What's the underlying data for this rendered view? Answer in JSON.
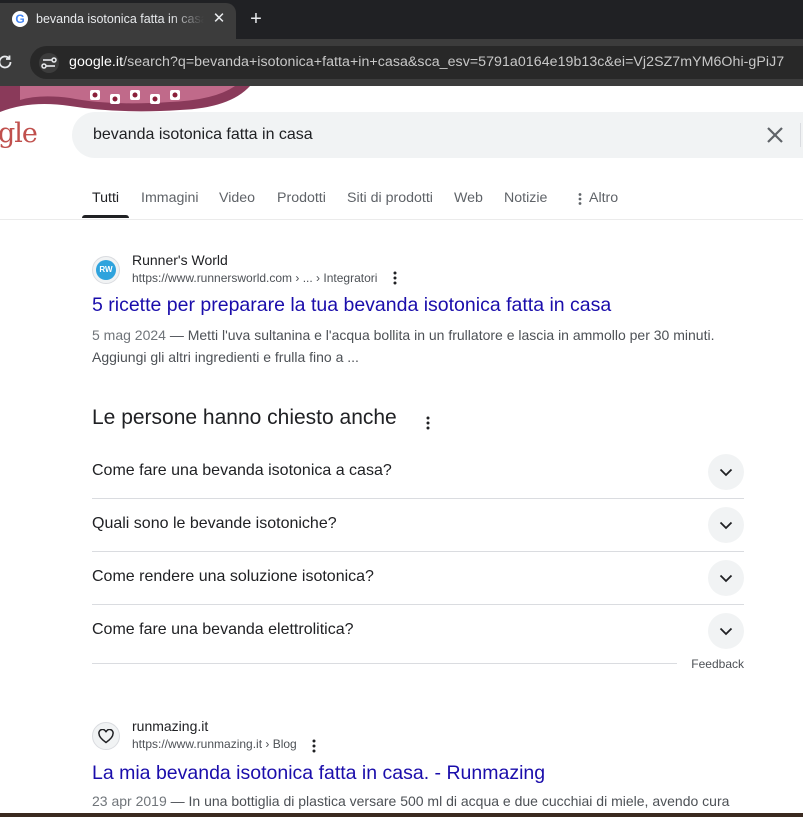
{
  "browser": {
    "tab_title": "bevanda isotonica fatta in casa - Cerca con Google",
    "tab_favicon_letter": "G",
    "close_glyph": "✕",
    "new_tab_glyph": "+",
    "url_host": "google.it",
    "url_rest": "/search?q=bevanda+isotonica+fatta+in+casa&sca_esv=5791a0164e19b13c&ei=Vj2SZ7mYM6Ohi-gPiJ7",
    "icons": [
      "reload-icon",
      "site-info-icon",
      "close-icon",
      "plus-icon"
    ]
  },
  "header": {
    "logo_fragment": "gle",
    "search_query": "bevanda isotonica fatta in casa",
    "clear_icon": "close-icon"
  },
  "nav": {
    "tabs": [
      {
        "label": "Tutti",
        "active": true
      },
      {
        "label": "Immagini"
      },
      {
        "label": "Video"
      },
      {
        "label": "Prodotti"
      },
      {
        "label": "Siti di prodotti"
      },
      {
        "label": "Web"
      },
      {
        "label": "Notizie"
      },
      {
        "label": "Altro"
      }
    ]
  },
  "results": [
    {
      "site_name": "Runner's World",
      "site_url": "https://www.runnersworld.com › ... › Integratori",
      "favicon_text": "RW",
      "title": "5 ricette per preparare la tua bevanda isotonica fatta in casa",
      "date": "5 mag 2024",
      "snippet": " — Metti l'uva sultanina e l'acqua bollita in un frullatore e lascia in ammollo per 30 minuti. Aggiungi gli altri ingredienti e frulla fino a ..."
    },
    {
      "site_name": "runmazing.it",
      "site_url": "https://www.runmazing.it › Blog",
      "favicon_icon": "heart-icon",
      "title": "La mia bevanda isotonica fatta in casa. - Runmazing",
      "date": "23 apr 2019",
      "snippet": " — In una bottiglia di plastica versare 500 ml di acqua e due cucchiai di miele, avendo cura"
    }
  ],
  "paa": {
    "title": "Le persone hanno chiesto anche",
    "questions": [
      "Come fare una bevanda isotonica a casa?",
      "Quali sono le bevande isotoniche?",
      "Come rendere una soluzione isotonica?",
      "Come fare una bevanda elettrolitica?"
    ],
    "feedback": "Feedback"
  },
  "colors": {
    "link": "#1a0dab",
    "chrome_dark": "#202124",
    "toolbar": "#3c3c3c"
  }
}
